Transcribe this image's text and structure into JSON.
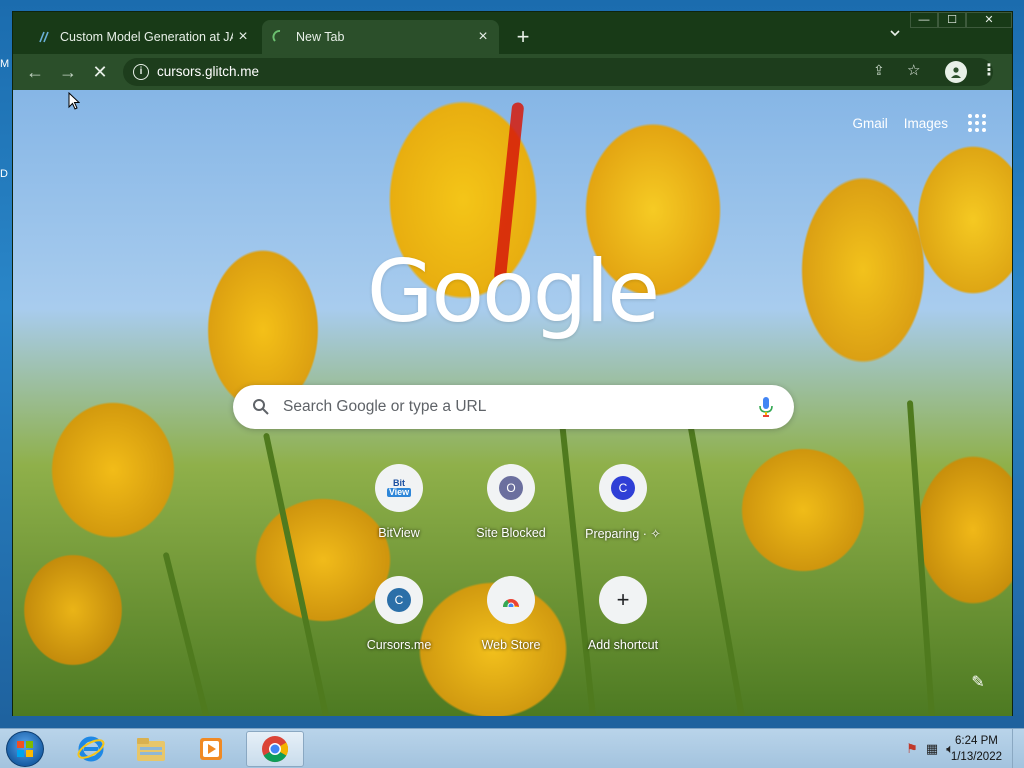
{
  "desktop": {
    "edge_labels": [
      "M",
      "D"
    ]
  },
  "tabs": [
    {
      "title": "Custom Model Generation at JAX",
      "close": "×",
      "active": false
    },
    {
      "title": "New Tab",
      "close": "×",
      "active": true
    }
  ],
  "tabstrip": {
    "new_tab": "+",
    "search_tabs": "⌄"
  },
  "window_controls": {
    "minimize": "—",
    "maximize": "☐",
    "close": "✕"
  },
  "toolbar": {
    "back": "←",
    "forward": "→",
    "stop": "✕",
    "url": "cursors.glitch.me",
    "site_info": "i",
    "share": "⇪",
    "bookmark": "☆",
    "menu": "⋮"
  },
  "ntp": {
    "links": {
      "gmail": "Gmail",
      "images": "Images"
    },
    "logo": "Google",
    "search_placeholder": "Search Google or type a URL",
    "shortcuts": [
      {
        "label": "BitView",
        "icon": "bitview-icon",
        "letter": "",
        "color": ""
      },
      {
        "label": "Site Blocked",
        "icon": "letter-icon",
        "letter": "O",
        "color": "#6b6f9e"
      },
      {
        "label": "Preparing · ✧",
        "icon": "letter-icon",
        "letter": "C",
        "color": "#2f3fd6"
      },
      {
        "label": "Cursors.me",
        "icon": "letter-icon",
        "letter": "C",
        "color": "#2b6fa8"
      },
      {
        "label": "Web Store",
        "icon": "chrome-web-store-icon",
        "letter": "",
        "color": ""
      },
      {
        "label": "Add shortcut",
        "icon": "plus-icon",
        "letter": "+",
        "color": ""
      }
    ],
    "customize": "✎"
  },
  "taskbar": {
    "pinned": [
      "internet-explorer-icon",
      "file-explorer-icon",
      "media-player-icon",
      "chrome-icon"
    ],
    "clock_time": "6:24 PM",
    "clock_date": "1/13/2022"
  },
  "colors": {
    "frame": "#183a17",
    "toolbar": "#2b4f2a",
    "omnibox": "#1d3d1c"
  }
}
